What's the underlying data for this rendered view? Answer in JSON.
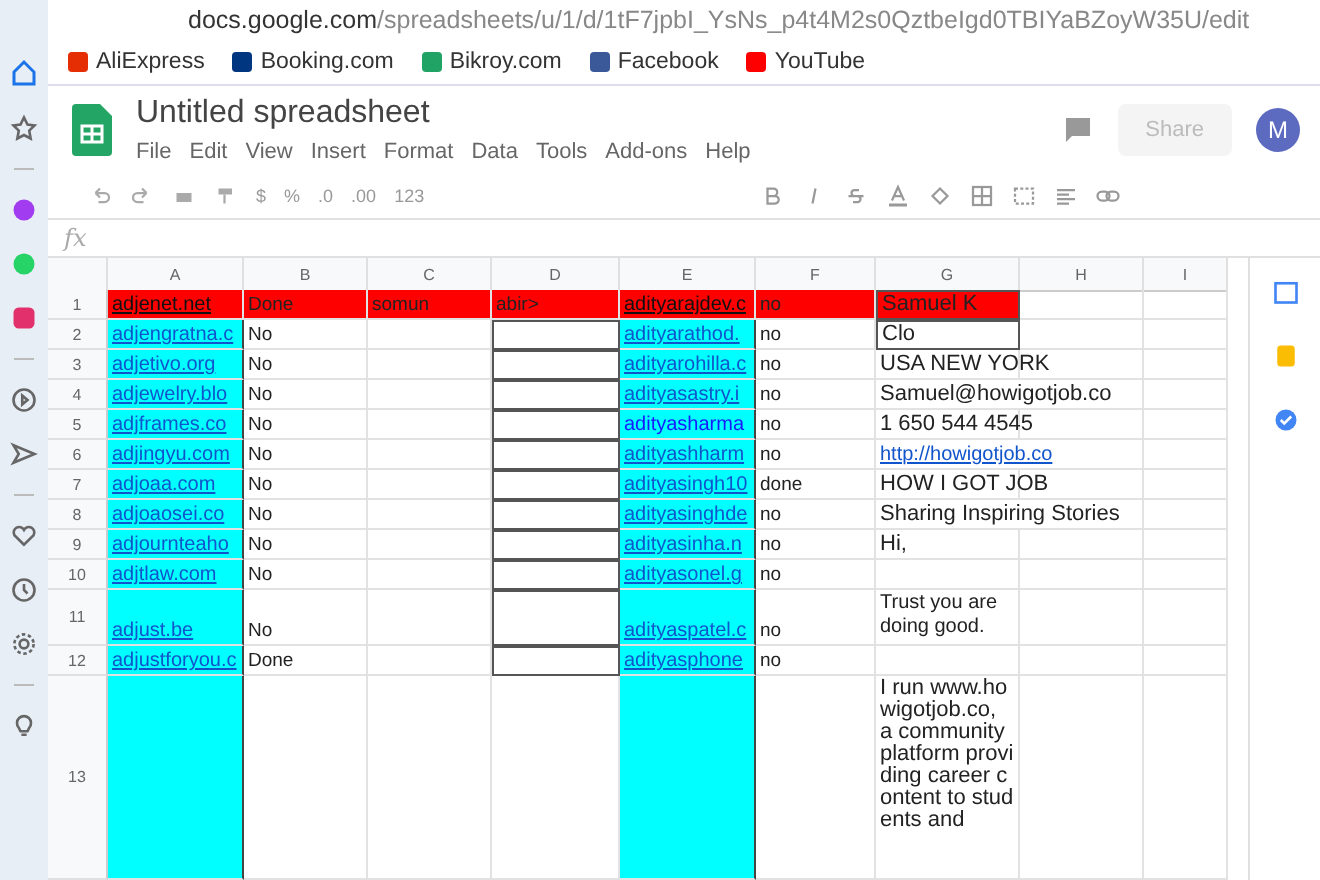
{
  "browser": {
    "url_host": "docs.google.com",
    "url_path": "/spreadsheets/u/1/d/1tF7jpbI_YsNs_p4t4M2s0QztbeIgd0TBIYaBZoyW35U/edit"
  },
  "bookmarks": [
    "AliExpress",
    "Booking.com",
    "Bikroy.com",
    "Facebook",
    "YouTube"
  ],
  "document": {
    "title": "Untitled spreadsheet",
    "menus": [
      "File",
      "Edit",
      "View",
      "Insert",
      "Format",
      "Data",
      "Tools",
      "Add-ons",
      "Help"
    ],
    "share": "Share",
    "avatar": "M"
  },
  "toolbar": {
    "currency": "$",
    "percent": "%",
    "decimals_less": ".0",
    "decimals_more": ".00",
    "number_format": "123"
  },
  "formula_bar": {
    "label": "fx"
  },
  "columns": [
    "A",
    "B",
    "C",
    "D",
    "E",
    "F",
    "G",
    "H",
    "I"
  ],
  "rows": [
    {
      "number": "1",
      "kind": "header",
      "a": "adjenet.net",
      "b": "Done",
      "c": "somun",
      "d": "abir>",
      "e": "adityarajdev.c",
      "f": "no",
      "g": "Samuel K"
    },
    {
      "number": "2",
      "kind": "data",
      "a": "adjengratna.c",
      "b": "No",
      "e": "adityarathod.",
      "f": "no",
      "g": "Clo"
    },
    {
      "number": "3",
      "kind": "data",
      "a": "adjetivo.org",
      "b": "No",
      "e": "adityarohilla.c",
      "f": "no",
      "g": "USA NEW YORK"
    },
    {
      "number": "4",
      "kind": "data",
      "a": "adjewelry.blo",
      "b": "No",
      "e": "adityasastry.i",
      "f": "no",
      "g": "Samuel@howigotjob.co"
    },
    {
      "number": "5",
      "kind": "data",
      "a": "adjframes.co",
      "b": "No",
      "e": "adityasharma",
      "f": "no",
      "g": "1 650 544 4545"
    },
    {
      "number": "6",
      "kind": "data",
      "a": "adjingyu.com",
      "b": "No",
      "e": "adityashharm",
      "f": "no",
      "g": "http://howigotjob.co",
      "g_link": true
    },
    {
      "number": "7",
      "kind": "data",
      "a": "adjoaa.com",
      "b": "No",
      "e": "adityasingh10",
      "f": "done",
      "g": "HOW I GOT JOB"
    },
    {
      "number": "8",
      "kind": "data",
      "a": "adjoaosei.co",
      "b": "No",
      "e": "adityasinghde",
      "f": "no",
      "g": "Sharing Inspiring Stories"
    },
    {
      "number": "9",
      "kind": "data",
      "a": "adjournteaho",
      "b": "No",
      "e": "adityasinha.n",
      "f": "no",
      "g": "Hi,"
    },
    {
      "number": "10",
      "kind": "data",
      "a": "adjtlaw.com",
      "b": "No",
      "e": "adityasonel.g",
      "f": "no"
    },
    {
      "number": "11",
      "kind": "tall",
      "a": "adjust.be",
      "b": "No",
      "e": "adityaspatel.c",
      "f": "no",
      "g": "Trust you are doing good."
    },
    {
      "number": "12",
      "kind": "data",
      "a": "adjustforyou.c",
      "b": "Done",
      "e": "adityasphone",
      "f": "no"
    },
    {
      "number": "13",
      "kind": "long",
      "g": "I run www.howigotjob.co, a community platform providing career content to students and"
    }
  ]
}
